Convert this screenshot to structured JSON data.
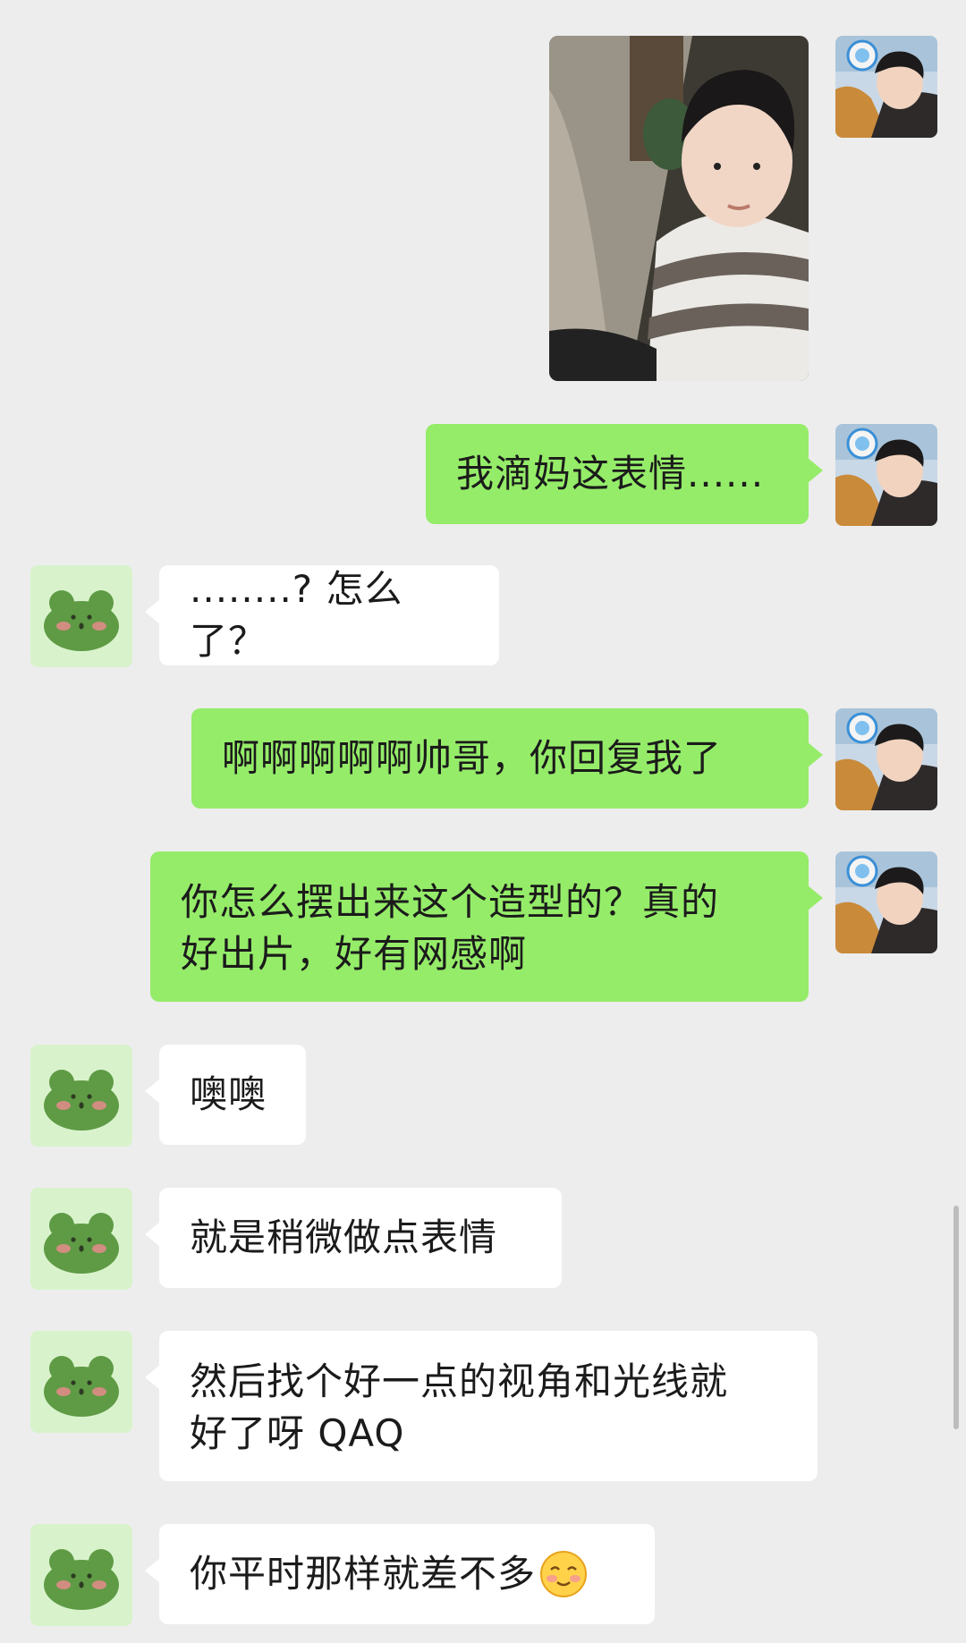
{
  "colors": {
    "background": "#ededed",
    "sent_bubble": "#95ec69",
    "received_bubble": "#ffffff",
    "text": "#1b1b1b"
  },
  "self_avatar_icon": "user-photo-avatar",
  "contact_avatar_icon": "green-frog-avatar",
  "messages": [
    {
      "side": "right",
      "kind": "image",
      "content": "selfie-photo"
    },
    {
      "side": "right",
      "kind": "text",
      "text": "我滴妈这表情......"
    },
    {
      "side": "left",
      "kind": "text",
      "text": "........? 怎么了？"
    },
    {
      "side": "right",
      "kind": "text",
      "text": "啊啊啊啊啊帅哥，你回复我了"
    },
    {
      "side": "right",
      "kind": "text",
      "line1": "你怎么摆出来这个造型的？真的",
      "line2": "好出片，好有网感啊"
    },
    {
      "side": "left",
      "kind": "text",
      "text": "噢噢"
    },
    {
      "side": "left",
      "kind": "text",
      "text": "就是稍微做点表情"
    },
    {
      "side": "left",
      "kind": "text",
      "line1": "然后找个好一点的视角和光线就",
      "line2": "好了呀 QAQ"
    },
    {
      "side": "left",
      "kind": "text",
      "text": "你平时那样就差不多",
      "emoji": "shy-smile-emoji"
    }
  ]
}
